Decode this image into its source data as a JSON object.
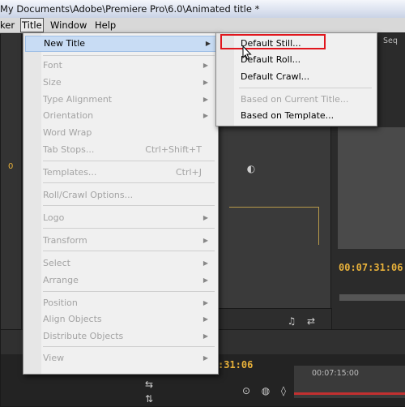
{
  "window": {
    "title": "My Documents\\Adobe\\Premiere Pro\\6.0\\Animated title *"
  },
  "menubar": {
    "items": [
      {
        "label": "ker",
        "active": false
      },
      {
        "label": "Title",
        "active": true
      },
      {
        "label": "Window",
        "active": false
      },
      {
        "label": "Help",
        "active": false
      }
    ]
  },
  "title_menu": {
    "items": [
      {
        "label": "New Title",
        "shortcut": "",
        "disabled": false,
        "submenu": true
      },
      {
        "label": "Font",
        "shortcut": "",
        "disabled": true,
        "submenu": true
      },
      {
        "label": "Size",
        "shortcut": "",
        "disabled": true,
        "submenu": true
      },
      {
        "label": "Type Alignment",
        "shortcut": "",
        "disabled": true,
        "submenu": true
      },
      {
        "label": "Orientation",
        "shortcut": "",
        "disabled": true,
        "submenu": true
      },
      {
        "label": "Word Wrap",
        "shortcut": "",
        "disabled": true,
        "submenu": false
      },
      {
        "label": "Tab Stops...",
        "shortcut": "Ctrl+Shift+T",
        "disabled": true,
        "submenu": false
      },
      {
        "label": "Templates...",
        "shortcut": "Ctrl+J",
        "disabled": true,
        "submenu": false
      },
      {
        "label": "Roll/Crawl Options...",
        "shortcut": "",
        "disabled": true,
        "submenu": false
      },
      {
        "label": "Logo",
        "shortcut": "",
        "disabled": true,
        "submenu": true
      },
      {
        "label": "Transform",
        "shortcut": "",
        "disabled": true,
        "submenu": true
      },
      {
        "label": "Select",
        "shortcut": "",
        "disabled": true,
        "submenu": true
      },
      {
        "label": "Arrange",
        "shortcut": "",
        "disabled": true,
        "submenu": true
      },
      {
        "label": "Position",
        "shortcut": "",
        "disabled": true,
        "submenu": true
      },
      {
        "label": "Align Objects",
        "shortcut": "",
        "disabled": true,
        "submenu": true
      },
      {
        "label": "Distribute Objects",
        "shortcut": "",
        "disabled": true,
        "submenu": true
      },
      {
        "label": "View",
        "shortcut": "",
        "disabled": true,
        "submenu": true
      }
    ]
  },
  "new_title_submenu": {
    "items": [
      {
        "label": "Default Still...",
        "disabled": false
      },
      {
        "label": "Default Roll...",
        "disabled": false
      },
      {
        "label": "Default Crawl...",
        "disabled": false
      },
      {
        "label": "Based on Current Title...",
        "disabled": true
      },
      {
        "label": "Based on Template...",
        "disabled": false
      }
    ]
  },
  "workspace": {
    "program_timecode": "00:07:31:06",
    "timeline_timecode": ":31:06",
    "ruler_time": "00:07:15:00",
    "left_value": "0",
    "panel_tab_fragment": "Seq"
  },
  "colors": {
    "highlight": "#e0161d",
    "timecode": "#e8b13a"
  }
}
